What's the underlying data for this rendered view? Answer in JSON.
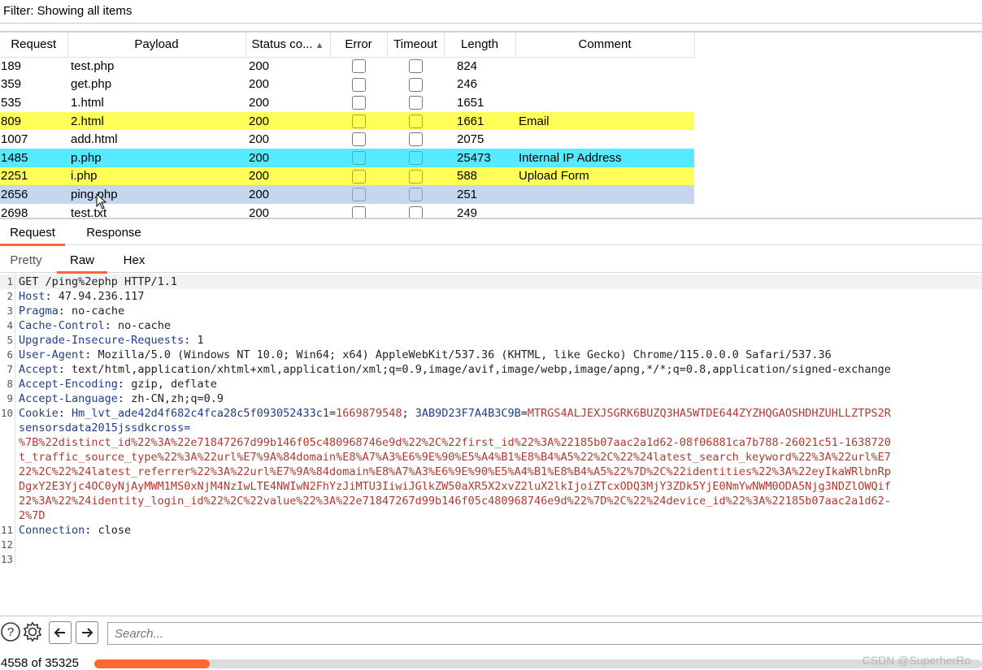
{
  "filter": {
    "text": "Filter: Showing all items"
  },
  "table": {
    "columns": [
      "Request",
      "Payload",
      "Status co...",
      "Error",
      "Timeout",
      "Length",
      "Comment"
    ],
    "rows": [
      {
        "request": "189",
        "payload": "test.php",
        "status": "200",
        "length": "824",
        "comment": "",
        "highlight": "none"
      },
      {
        "request": "359",
        "payload": "get.php",
        "status": "200",
        "length": "246",
        "comment": "",
        "highlight": "none"
      },
      {
        "request": "535",
        "payload": "1.html",
        "status": "200",
        "length": "1651",
        "comment": "",
        "highlight": "none"
      },
      {
        "request": "809",
        "payload": "2.html",
        "status": "200",
        "length": "1661",
        "comment": "Email",
        "highlight": "yellow"
      },
      {
        "request": "1007",
        "payload": "add.html",
        "status": "200",
        "length": "2075",
        "comment": "",
        "highlight": "none"
      },
      {
        "request": "1485",
        "payload": "p.php",
        "status": "200",
        "length": "25473",
        "comment": "Internal IP Address",
        "highlight": "cyan"
      },
      {
        "request": "2251",
        "payload": "i.php",
        "status": "200",
        "length": "588",
        "comment": "Upload Form",
        "highlight": "yellow"
      },
      {
        "request": "2656",
        "payload": "ping.php",
        "status": "200",
        "length": "251",
        "comment": "",
        "highlight": "selected"
      },
      {
        "request": "2698",
        "payload": "test.txt",
        "status": "200",
        "length": "249",
        "comment": "",
        "highlight": "none"
      }
    ]
  },
  "tabs": {
    "request": "Request",
    "response": "Response",
    "active": "Request"
  },
  "view_tabs": {
    "pretty": "Pretty",
    "raw": "Raw",
    "hex": "Hex",
    "active": "Raw"
  },
  "editor": {
    "lines": [
      {
        "n": "1",
        "plain": "GET /ping%2ephp HTTP/1.1"
      },
      {
        "n": "2",
        "key": "Host",
        "val": " 47.94.236.117"
      },
      {
        "n": "3",
        "key": "Pragma",
        "val": " no-cache"
      },
      {
        "n": "4",
        "key": "Cache-Control",
        "val": " no-cache"
      },
      {
        "n": "5",
        "key": "Upgrade-Insecure-Requests",
        "val": " 1"
      },
      {
        "n": "6",
        "key": "User-Agent",
        "val": " Mozilla/5.0 (Windows NT 10.0; Win64; x64) AppleWebKit/537.36 (KHTML, like Gecko) Chrome/115.0.0.0 Safari/537.36"
      },
      {
        "n": "7",
        "key": "Accept",
        "val": " text/html,application/xhtml+xml,application/xml;q=0.9,image/avif,image/webp,image/apng,*/*;q=0.8,application/signed-exchange"
      },
      {
        "n": "8",
        "key": "Accept-Encoding",
        "val": " gzip, deflate"
      },
      {
        "n": "9",
        "key": "Accept-Language",
        "val": " zh-CN,zh;q=0.9"
      },
      {
        "n": "10",
        "key": "Cookie",
        "c1k": "Hm_lvt_ade42d4f682c4fca28c5f093052433c1",
        "c1v": "1669879548",
        "c2k": "3AB9D23F7A4B3C9B",
        "c2v": "MTRGS4ALJEXJSGRK6BUZQ3HA5WTDE644ZYZHQGAOSHDHZUHLLZTPS2R"
      },
      {
        "n": "",
        "cookie_key": "sensorsdata2015jssdkcross="
      },
      {
        "n": "",
        "cookie_val": "%7B%22distinct_id%22%3A%22e71847267d99b146f05c480968746e9d%22%2C%22first_id%22%3A%22185b07aac2a1d62-08f06881ca7b788-26021c51-1638720"
      },
      {
        "n": "",
        "cookie_val": "t_traffic_source_type%22%3A%22url%E7%9A%84domain%E8%A7%A3%E6%9E%90%E5%A4%B1%E8%B4%A5%22%2C%22%24latest_search_keyword%22%3A%22url%E7"
      },
      {
        "n": "",
        "cookie_val": "22%2C%22%24latest_referrer%22%3A%22url%E7%9A%84domain%E8%A7%A3%E6%9E%90%E5%A4%B1%E8%B4%A5%22%7D%2C%22identities%22%3A%22eyIkaWRlbnRp"
      },
      {
        "n": "",
        "cookie_val": "DgxY2E3Yjc4OC0yNjAyMWM1MS0xNjM4NzIwLTE4NWIwN2FhYzJiMTU3IiwiJGlkZW50aXR5X2xvZ2luX2lkIjoiZTcxODQ3MjY3ZDk5YjE0NmYwNWM0ODA5Njg3NDZlOWQif"
      },
      {
        "n": "",
        "cookie_val": "22%3A%22%24identity_login_id%22%2C%22value%22%3A%22e71847267d99b146f05c480968746e9d%22%7D%2C%22%24device_id%22%3A%22185b07aac2a1d62-"
      },
      {
        "n": "",
        "cookie_val": "2%7D"
      },
      {
        "n": "11",
        "key": "Connection",
        "val": " close"
      },
      {
        "n": "12",
        "plain": ""
      },
      {
        "n": "13",
        "plain": ""
      }
    ]
  },
  "search": {
    "placeholder": "Search..."
  },
  "status": {
    "count": "4558 of 35325",
    "progress": 0.13,
    "progress_color": "#ff6a33"
  },
  "watermark": "CSDN @SuperherRo"
}
